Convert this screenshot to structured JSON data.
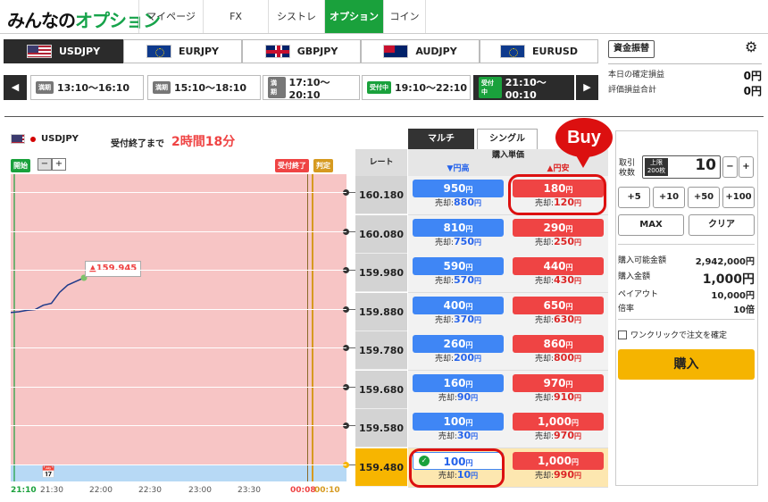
{
  "header": {
    "logo_pre": "みんなの",
    "logo_post": "オプション",
    "nav": [
      "マイページ",
      "FX",
      "シストレ",
      "オプション",
      "コイン"
    ],
    "active_nav": "オプション"
  },
  "pairs": [
    {
      "label": "USDJPY",
      "flag": "us-jp",
      "active": true
    },
    {
      "label": "EURJPY",
      "flag": "eu-jp",
      "active": false
    },
    {
      "label": "GBPJPY",
      "flag": "gb-jp",
      "active": false
    },
    {
      "label": "AUDJPY",
      "flag": "au-jp",
      "active": false
    },
    {
      "label": "EURUSD",
      "flag": "eu-us",
      "active": false
    }
  ],
  "time_slots": [
    {
      "badge": "満期",
      "time": "13:10〜16:10"
    },
    {
      "badge": "満期",
      "time": "15:10〜18:10"
    },
    {
      "badge": "満期",
      "time": "17:10〜20:10"
    },
    {
      "badge": "受付中",
      "time": "19:10〜22:10"
    },
    {
      "badge": "受付中",
      "time": "21:10〜00:10"
    }
  ],
  "nav_prev": "◀",
  "nav_next": "▶",
  "account": {
    "fund_button": "資金振替",
    "gear_icon": "⚙",
    "pnl_label": "本日の確定損益",
    "pnl_value": "0円",
    "eval_label": "評価損益合計",
    "eval_value": "0円"
  },
  "chart": {
    "pair": "USDJPY",
    "deadline_label": "受付終了まで",
    "deadline_value": "2時間18分",
    "start_badge": "開始",
    "zoom_out": "−",
    "zoom_in": "+",
    "end_badge": "受付終了",
    "judge_badge": "判定",
    "current_price": "▲159.945",
    "calendar_icon": "📅",
    "x_ticks": [
      "21:10",
      "21:30",
      "22:00",
      "22:30",
      "23:00",
      "23:30",
      "00:08",
      "00:10"
    ]
  },
  "chart_data": {
    "type": "line",
    "x": [
      "21:10",
      "21:15",
      "21:20",
      "21:25",
      "21:30",
      "21:35",
      "21:40",
      "21:45",
      "21:50",
      "21:55"
    ],
    "values": [
      159.85,
      159.852,
      159.856,
      159.858,
      159.87,
      159.875,
      159.905,
      159.925,
      159.935,
      159.945
    ],
    "ylim": [
      159.48,
      160.18
    ]
  },
  "tabs": {
    "multi": "マルチ",
    "single": "シングル"
  },
  "grid_header": {
    "rate": "レート",
    "price": "購入単価",
    "up": "▼円高",
    "down": "▲円安"
  },
  "rows": [
    {
      "rate": "160.180",
      "up_buy": "950",
      "up_sell": "880",
      "down_buy": "180",
      "down_sell": "120"
    },
    {
      "rate": "160.080",
      "up_buy": "810",
      "up_sell": "750",
      "down_buy": "290",
      "down_sell": "250"
    },
    {
      "rate": "159.980",
      "up_buy": "590",
      "up_sell": "570",
      "down_buy": "440",
      "down_sell": "430"
    },
    {
      "rate": "159.880",
      "up_buy": "400",
      "up_sell": "370",
      "down_buy": "650",
      "down_sell": "630"
    },
    {
      "rate": "159.780",
      "up_buy": "260",
      "up_sell": "200",
      "down_buy": "860",
      "down_sell": "800"
    },
    {
      "rate": "159.680",
      "up_buy": "160",
      "up_sell": "90",
      "down_buy": "970",
      "down_sell": "910"
    },
    {
      "rate": "159.580",
      "up_buy": "100",
      "up_sell": "30",
      "down_buy": "1,000",
      "down_sell": "970"
    },
    {
      "rate": "159.480",
      "up_buy": "100",
      "up_sell": "10",
      "down_buy": "1,000",
      "down_sell": "990"
    }
  ],
  "yen": "円",
  "sell_label": "売却:",
  "buy_callout": "Buy",
  "order": {
    "qty_label1": "取引",
    "qty_label2": "枚数",
    "max_badge1": "上限",
    "max_badge2": "200枚",
    "qty_value": "10",
    "minus": "−",
    "plus": "+",
    "steps": [
      "+5",
      "+10",
      "+50",
      "+100"
    ],
    "max_button": "MAX",
    "clear_button": "クリア",
    "avail_label": "購入可能金額",
    "avail_value": "2,942,000円",
    "amount_label": "購入金額",
    "amount_value": "1,000円",
    "payout_label": "ペイアウト",
    "payout_value": "10,000円",
    "ratio_label": "倍率",
    "ratio_value": "10倍",
    "oneclick_label": "ワンクリックで注文を確定",
    "buy_button": "購入"
  }
}
